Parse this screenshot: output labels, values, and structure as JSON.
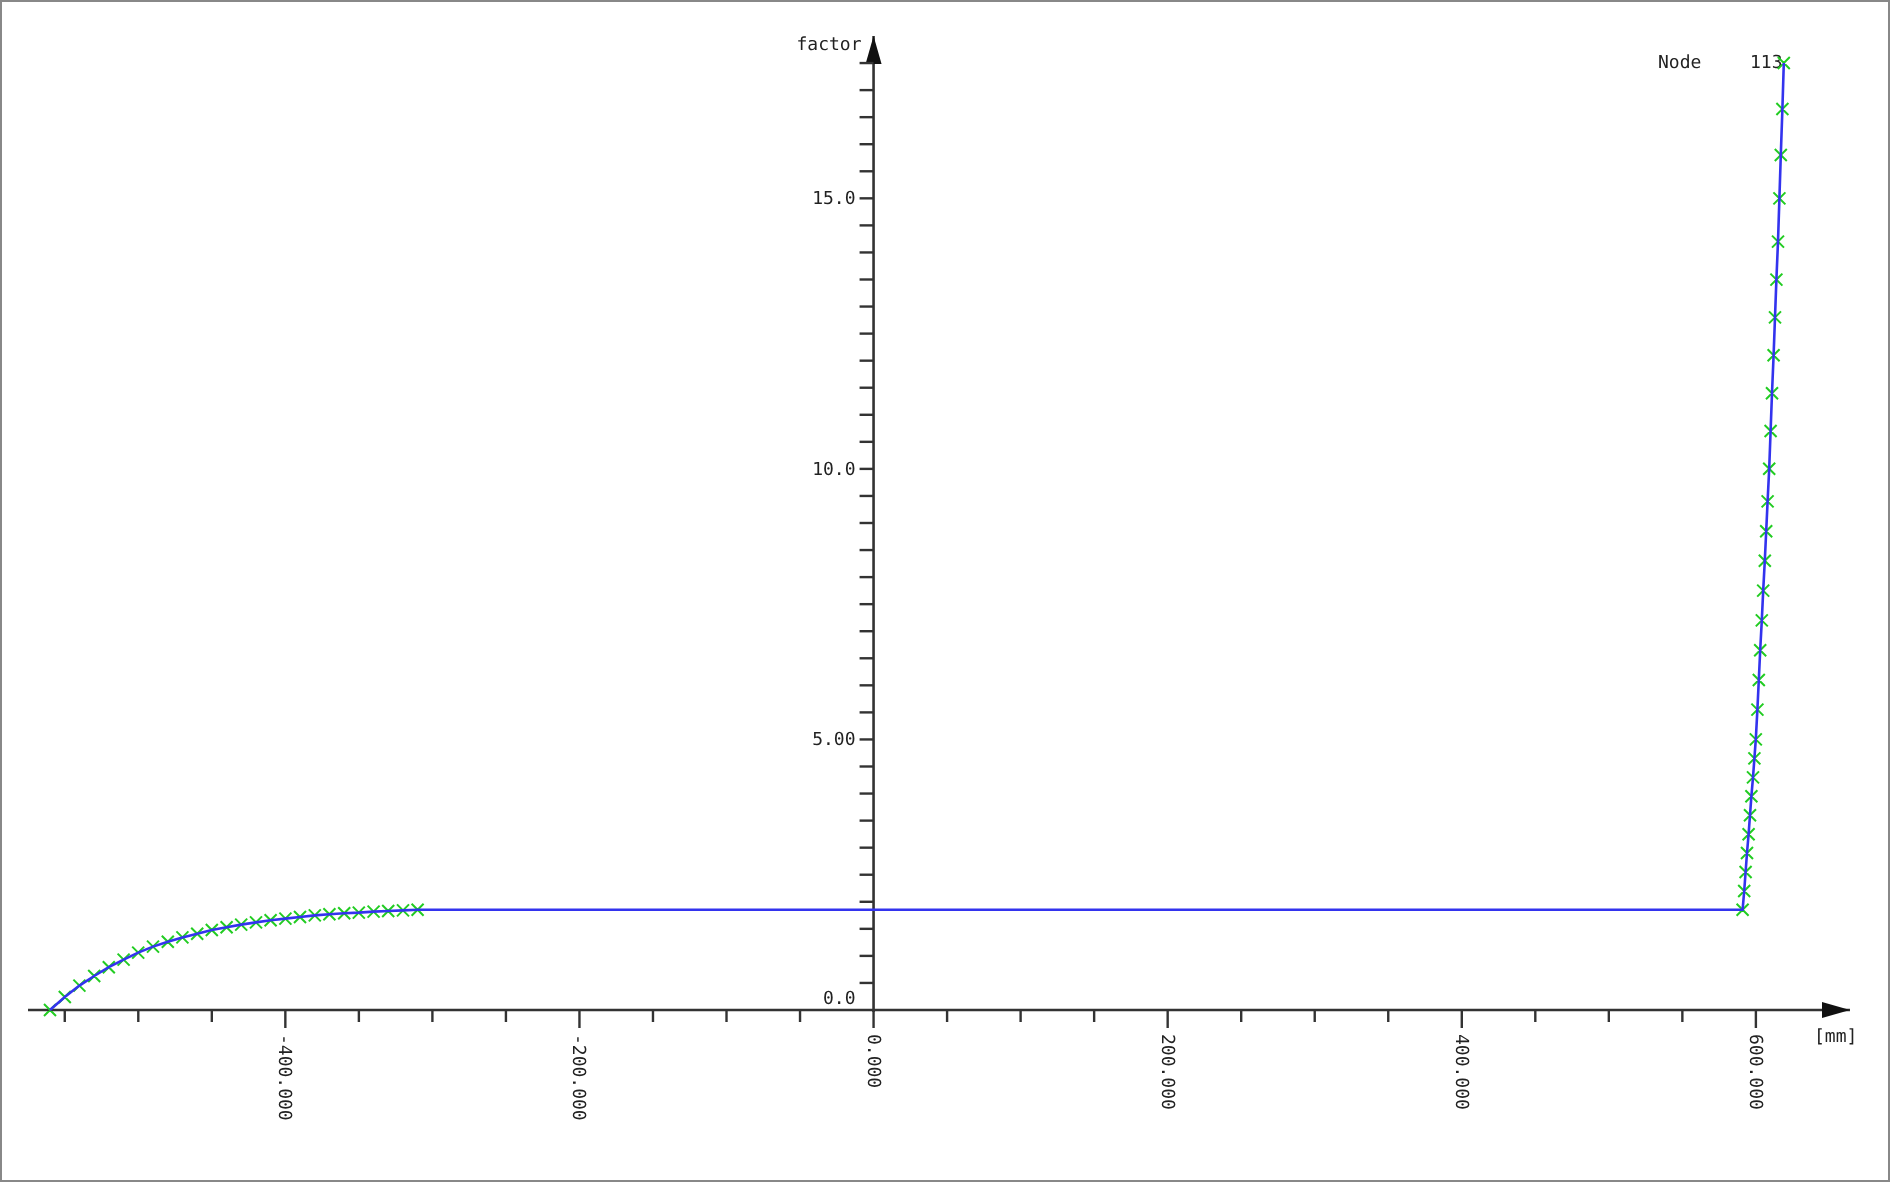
{
  "legend": {
    "label": "Node",
    "value": "113"
  },
  "chart_data": {
    "type": "line",
    "xlabel": "[mm]",
    "ylabel": "factor",
    "xlim": [
      -575,
      664
    ],
    "ylim": [
      0,
      18
    ],
    "xticks": [
      {
        "value": -400,
        "label": "-400.000"
      },
      {
        "value": -200,
        "label": "-200.000"
      },
      {
        "value": 0,
        "label": "0.000"
      },
      {
        "value": 200,
        "label": "200.000"
      },
      {
        "value": 400,
        "label": "400.000"
      },
      {
        "value": 600,
        "label": "600.000"
      }
    ],
    "yticks": [
      {
        "value": 0,
        "label": "0.0"
      },
      {
        "value": 5,
        "label": "5.00"
      },
      {
        "value": 10,
        "label": "10.0"
      },
      {
        "value": 15,
        "label": "15.0"
      }
    ],
    "x": [
      -560,
      -550,
      -540,
      -530,
      -520,
      -510,
      -500,
      -490,
      -480,
      -470,
      -460,
      -450,
      -440,
      -430,
      -420,
      -410,
      -400,
      -390,
      -380,
      -370,
      -360,
      -350,
      -340,
      -330,
      -320,
      -310,
      591,
      592,
      593,
      594,
      595,
      596,
      597,
      598,
      599,
      600,
      601,
      602,
      603,
      604,
      605,
      606,
      607,
      608,
      609,
      610,
      611,
      612,
      613,
      614,
      615,
      616,
      617,
      618,
      619
    ],
    "series": [
      {
        "color": "#3333ee",
        "marker": "x",
        "values": [
          0,
          0.24,
          0.45,
          0.63,
          0.79,
          0.93,
          1.06,
          1.17,
          1.26,
          1.34,
          1.41,
          1.48,
          1.53,
          1.58,
          1.62,
          1.66,
          1.69,
          1.72,
          1.75,
          1.77,
          1.79,
          1.8,
          1.82,
          1.83,
          1.84,
          1.85,
          1.85,
          2.2,
          2.55,
          2.9,
          3.25,
          3.6,
          3.95,
          4.3,
          4.65,
          5,
          5.55,
          6.1,
          6.65,
          7.2,
          7.75,
          8.3,
          8.85,
          9.4,
          10,
          10.7,
          11.4,
          12.1,
          12.8,
          13.5,
          14.2,
          15,
          15.8,
          16.65,
          17.5
        ]
      }
    ]
  }
}
